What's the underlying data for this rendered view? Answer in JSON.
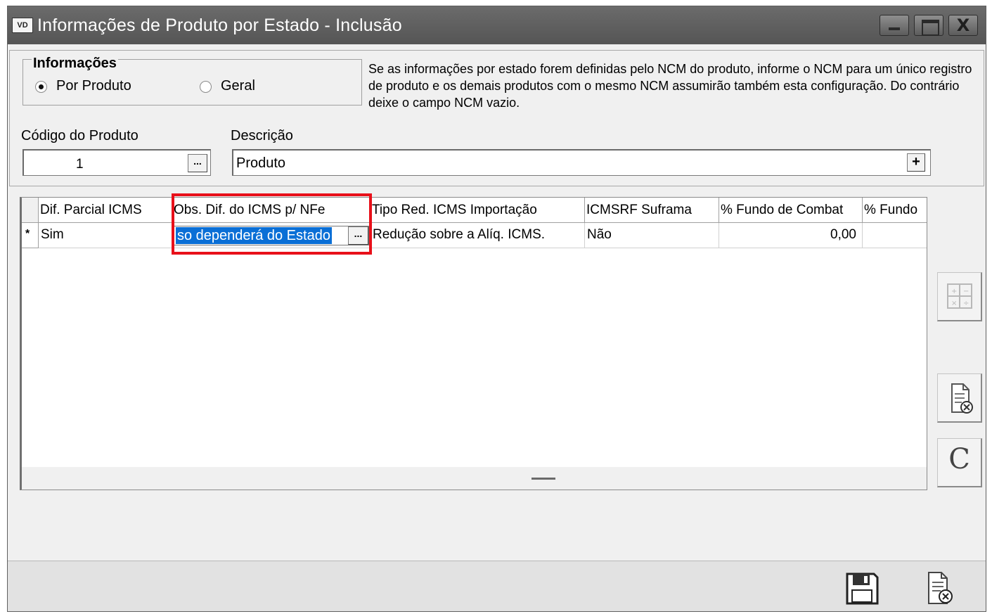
{
  "window": {
    "icon_text": "VD",
    "title": "Informações de Produto por Estado - Inclusão",
    "close_glyph": "X"
  },
  "info_group": {
    "legend": "Informações",
    "options": [
      {
        "label": "Por Produto",
        "selected": true
      },
      {
        "label": "Geral",
        "selected": false
      }
    ],
    "note": "Se as informações por estado forem definidas pelo NCM do produto, informe o NCM para um único registro de produto e os demais produtos com o mesmo NCM assumirão também esta configuração. Do contrário deixe o campo NCM vazio."
  },
  "fields": {
    "codigo_label": "Código do Produto",
    "codigo_value": "1",
    "codigo_lookup": "...",
    "descricao_label": "Descrição",
    "descricao_value": "Produto",
    "descricao_plus": "+"
  },
  "grid": {
    "headers": [
      "Dif. Parcial ICMS",
      "Obs. Dif. do ICMS p/ NFe",
      "Tipo Red. ICMS Importação",
      "ICMSRF Suframa",
      "% Fundo de Combat",
      "% Fundo"
    ],
    "row_indicator": "*",
    "row": {
      "dif_parcial": "Sim",
      "obs_dif": "so dependerá do Estado",
      "obs_lookup": "...",
      "tipo_red": "Redução sobre a Alíq. ICMS.",
      "suframa": "Não",
      "fundo_combate": "0,00",
      "fundo": ""
    }
  },
  "side_buttons": {
    "c_label": "C"
  },
  "colors": {
    "selection": "#0a6fd6",
    "highlight": "#e8101a",
    "titlebar": "#5f5f5f"
  }
}
